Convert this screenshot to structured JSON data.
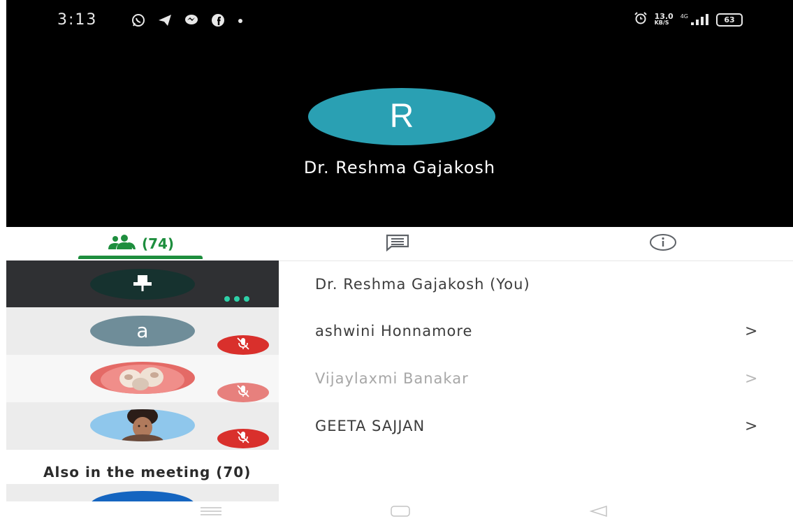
{
  "status_bar": {
    "time": "3:13",
    "notification_icons": [
      "whatsapp-icon",
      "telegram-icon",
      "messenger-icon",
      "facebook-icon",
      "dot-icon"
    ],
    "net_speed_value": "13.0",
    "net_speed_unit": "KB/S",
    "network": "4G",
    "battery": "63"
  },
  "speaker": {
    "initial": "R",
    "name": "Dr. Reshma Gajakosh",
    "avatar_color": "#2aa0b3"
  },
  "tabs": {
    "people_count": "(74)",
    "active": "people",
    "accent": "#1e8e3e"
  },
  "participants": [
    {
      "name": "Dr. Reshma Gajakosh (You)",
      "muted": false
    },
    {
      "name": "ashwini Honnamore",
      "initial": "a",
      "muted": true,
      "chevron": ">"
    },
    {
      "name": "Vijaylaxmi Banakar",
      "muted": true,
      "chevron": ">"
    },
    {
      "name": "GEETA SAJJAN",
      "muted": true,
      "chevron": ">"
    }
  ],
  "also_in_meeting": {
    "title": "Also in the meeting (70)"
  },
  "colors": {
    "mute_red": "#d9302c",
    "pinned_row_bg": "#2f3033",
    "more_dots": "#2fd0a8"
  }
}
